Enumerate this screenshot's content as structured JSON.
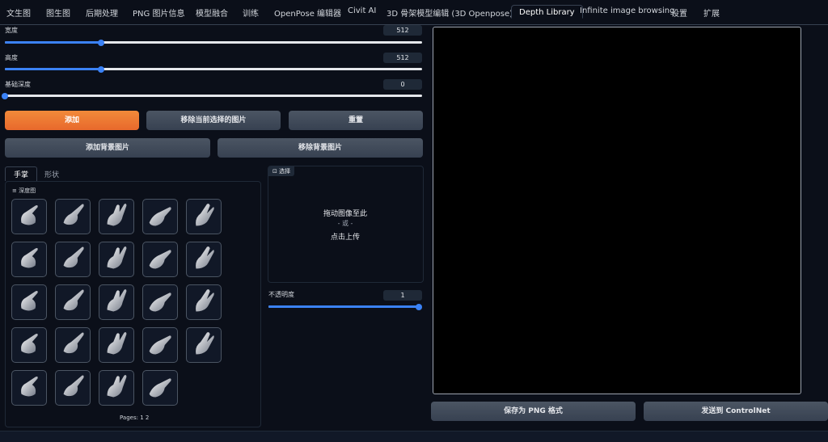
{
  "tabs": [
    "文生图",
    "图生图",
    "后期处理",
    "PNG 图片信息",
    "模型融合",
    "训练",
    "OpenPose 编辑器",
    "Civit AI",
    "3D 骨架模型编辑 (3D Openpose)",
    "Depth Library",
    "Infinite image browsing",
    "设置",
    "扩展"
  ],
  "active_tab": "Depth Library",
  "sliders": {
    "width": {
      "label": "宽度",
      "value": "512",
      "fraction": 0.23
    },
    "height": {
      "label": "高度",
      "value": "512",
      "fraction": 0.23
    },
    "base_depth": {
      "label": "基础深度",
      "value": "0",
      "fraction": 0.0
    },
    "opacity": {
      "label": "不透明度",
      "value": "1",
      "fraction": 1.0
    }
  },
  "buttons": {
    "add": "添加",
    "remove_selected": "移除当前选择的图片",
    "reset": "重置",
    "add_background": "添加背景图片",
    "remove_background": "移除背景图片",
    "save_png": "保存为 PNG 格式",
    "send_controlnet": "发送到 ControlNet"
  },
  "library": {
    "subtabs": [
      "手掌",
      "形状"
    ],
    "active_subtab": "手掌",
    "gallery_label": "深度图",
    "items": 24,
    "pages_label": "Pages:",
    "pages": [
      "1",
      "2"
    ]
  },
  "upload": {
    "label": "选择",
    "drag": "拖动图像至此",
    "or": "- 或 -",
    "click": "点击上传"
  },
  "colors": {
    "accent": "#f97316",
    "slider": "#3b82f6",
    "background": "#0b0f19"
  }
}
